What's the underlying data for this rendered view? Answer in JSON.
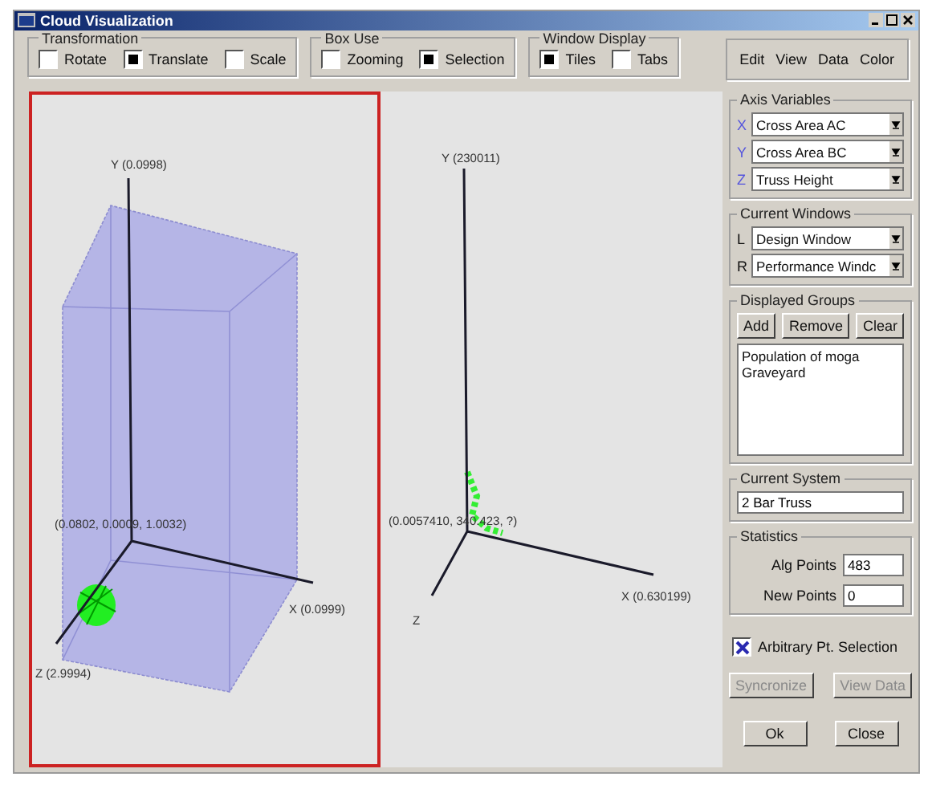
{
  "window": {
    "title": "Cloud Visualization"
  },
  "toolbar_groups": [
    {
      "title": "Transformation",
      "options": [
        {
          "label": "Rotate",
          "checked": false
        },
        {
          "label": "Translate",
          "checked": true
        },
        {
          "label": "Scale",
          "checked": false
        }
      ]
    },
    {
      "title": "Box Use",
      "options": [
        {
          "label": "Zooming",
          "checked": false
        },
        {
          "label": "Selection",
          "checked": true
        }
      ]
    },
    {
      "title": "Window Display",
      "options": [
        {
          "label": "Tiles",
          "checked": true
        },
        {
          "label": "Tabs",
          "checked": false
        }
      ]
    }
  ],
  "menu": [
    "Edit",
    "View",
    "Data",
    "Color"
  ],
  "plots": [
    {
      "kind": "box",
      "selected": true,
      "y_label": "Y (0.0998)",
      "x_label": "X (0.0999)",
      "z_label": "Z (2.9994)",
      "origin_label": "(0.0802, 0.0009, 1.0032)"
    },
    {
      "kind": "plain",
      "selected": false,
      "y_label": "Y (230011)",
      "x_label": "X (0.630199)",
      "z_label": "Z",
      "origin_label": "(0.0057410, 340.423, ?)"
    }
  ],
  "axis_variables": {
    "title": "Axis Variables",
    "rows": [
      {
        "axis": "X",
        "value": "Cross Area AC"
      },
      {
        "axis": "Y",
        "value": "Cross Area BC"
      },
      {
        "axis": "Z",
        "value": "Truss Height"
      }
    ]
  },
  "current_windows": {
    "title": "Current Windows",
    "rows": [
      {
        "axis": "L",
        "value": "Design Window"
      },
      {
        "axis": "R",
        "value": "Performance Windc"
      }
    ]
  },
  "displayed_groups": {
    "title": "Displayed Groups",
    "buttons": [
      "Add",
      "Remove",
      "Clear"
    ],
    "items": [
      "Population of moga",
      "Graveyard"
    ]
  },
  "current_system": {
    "title": "Current System",
    "value": "2 Bar Truss"
  },
  "statistics": {
    "title": "Statistics",
    "rows": [
      {
        "label": "Alg Points",
        "value": "483"
      },
      {
        "label": "New Points",
        "value": "0"
      }
    ]
  },
  "arbitrary_selection": {
    "label": "Arbitrary Pt. Selection",
    "checked": true
  },
  "action_buttons": [
    {
      "label": "Syncronize",
      "disabled": true
    },
    {
      "label": "View Data",
      "disabled": true
    }
  ],
  "dialog_buttons": [
    {
      "label": "Ok",
      "disabled": false
    },
    {
      "label": "Close",
      "disabled": false
    }
  ]
}
